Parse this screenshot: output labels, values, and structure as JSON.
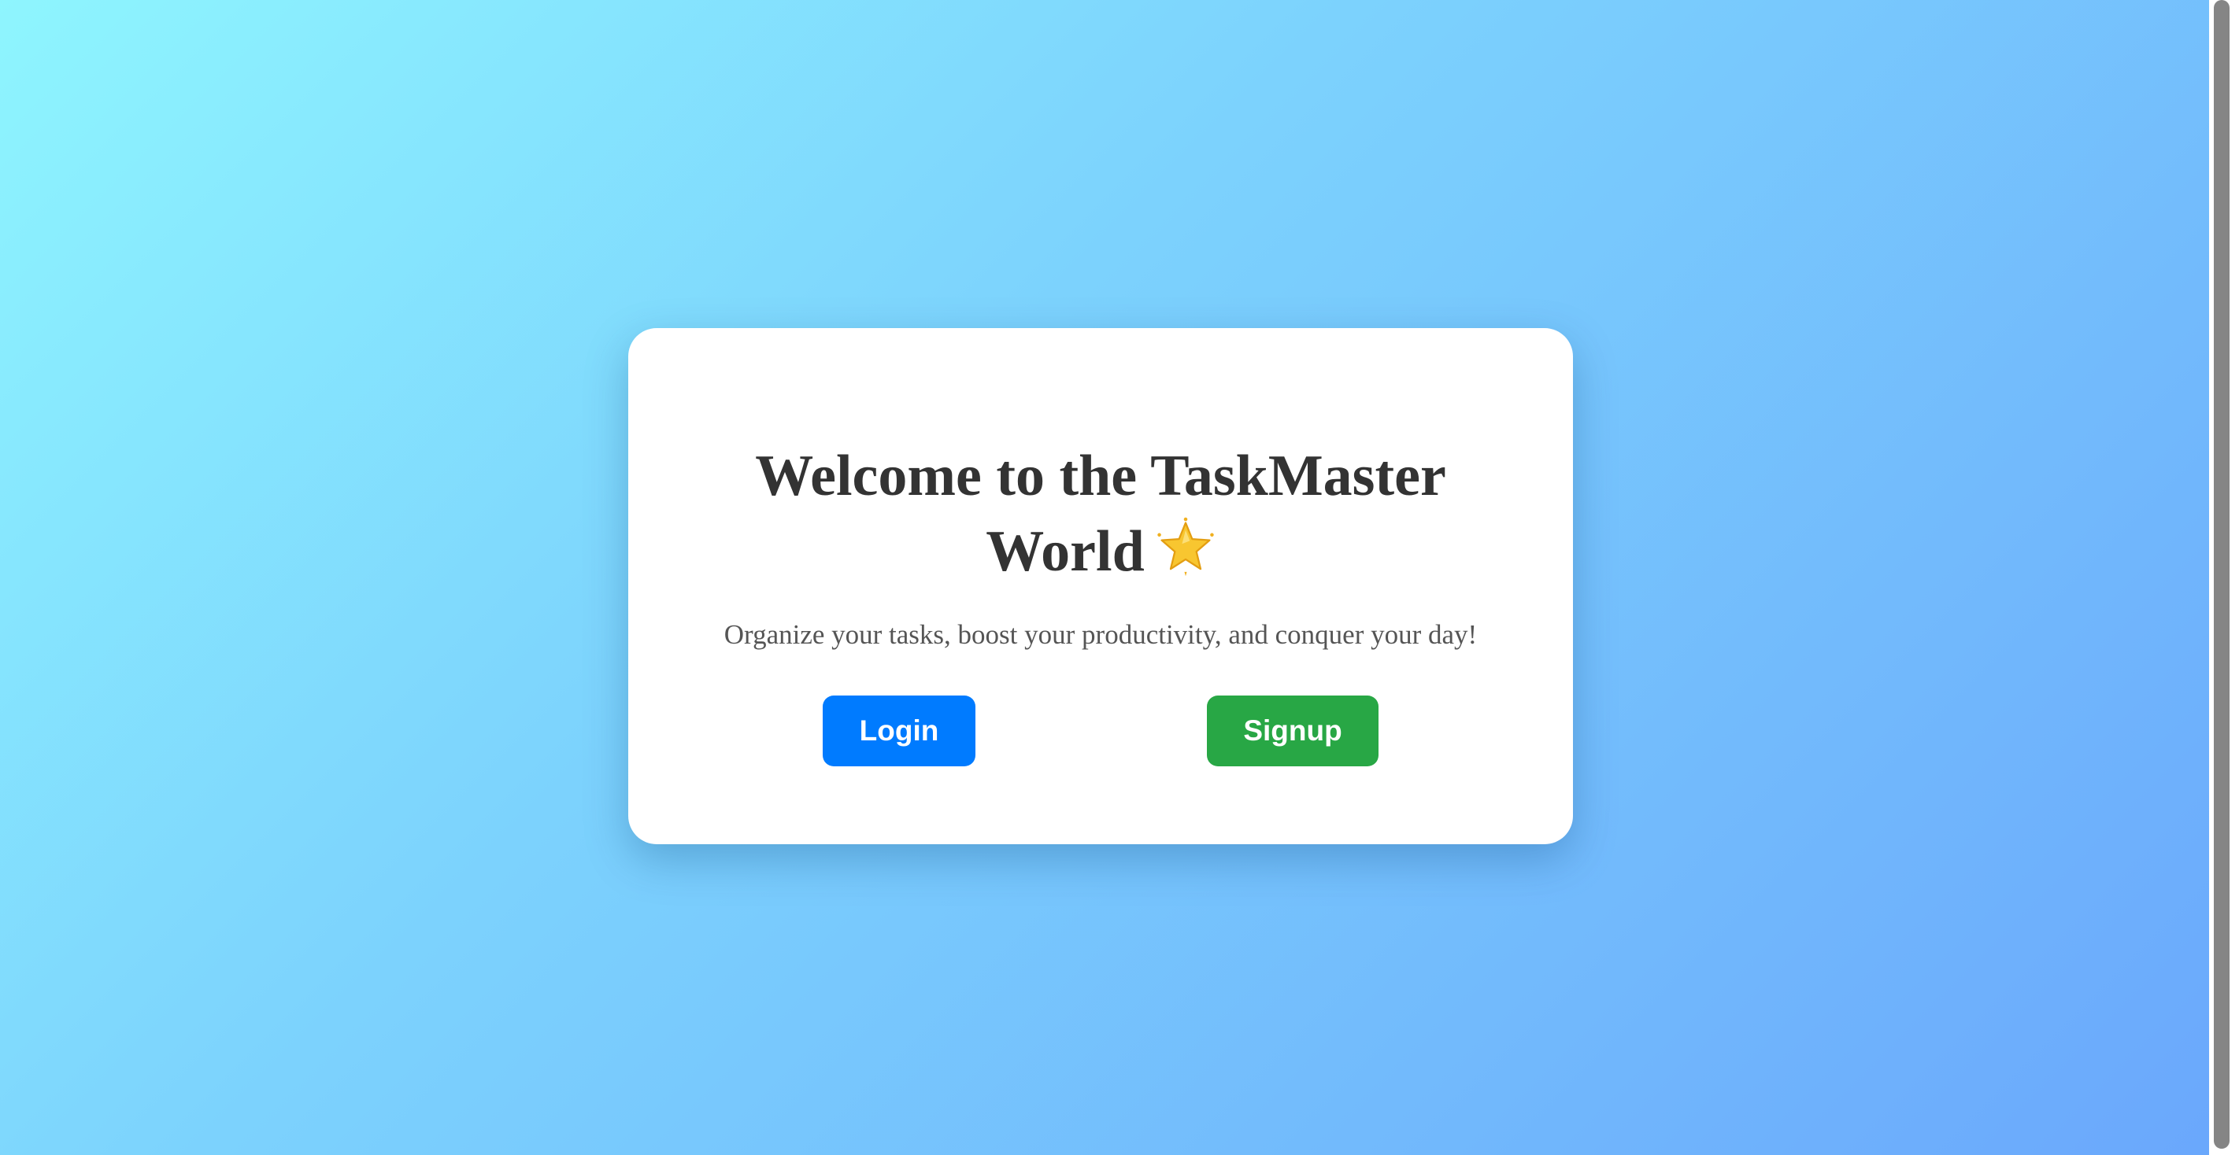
{
  "card": {
    "title_line1": "Welcome to the TaskMaster",
    "title_line2": "World",
    "title_icon": "glowing-star-icon",
    "subtitle": "Organize your tasks, boost your productivity, and conquer your day!"
  },
  "buttons": {
    "login_label": "Login",
    "signup_label": "Signup"
  },
  "colors": {
    "login": "#007bff",
    "signup": "#28a745",
    "title_text": "#333333",
    "subtitle_text": "#555555",
    "background_start": "#8ef5fe",
    "background_end": "#6aa7fc"
  }
}
